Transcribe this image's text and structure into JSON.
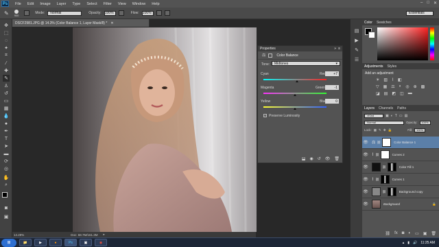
{
  "app": {
    "logo": "Ps"
  },
  "menu": [
    "File",
    "Edit",
    "Image",
    "Layer",
    "Type",
    "Select",
    "Filter",
    "View",
    "Window",
    "Help"
  ],
  "options": {
    "brush_size": "900",
    "mode_label": "Mode:",
    "mode_value": "Normal",
    "opacity_label": "Opacity:",
    "opacity_value": "100%",
    "flow_label": "Flow:",
    "flow_value": "100%",
    "workspace": "Essentials"
  },
  "document": {
    "tab_title": "DSCF2981.JPG @ 14.3% (Color Balance 1, Layer Mask/8) *",
    "zoom": "14.29%",
    "doc_info": "Doc: 68.7M/161.3M"
  },
  "properties": {
    "panel_title": "Properties",
    "adjustment_name": "Color Balance",
    "tone_label": "Tone:",
    "tone_value": "Midtones",
    "sliders": [
      {
        "left": "Cyan",
        "right": "Red",
        "value": "+7",
        "pos": 0.535
      },
      {
        "left": "Magenta",
        "right": "Green",
        "value": "-1",
        "pos": 0.495
      },
      {
        "left": "Yellow",
        "right": "Blue",
        "value": "0",
        "pos": 0.5
      }
    ],
    "preserve_luminosity": "Preserve Luminosity"
  },
  "color_panel": {
    "tabs": [
      "Color",
      "Swatches"
    ]
  },
  "adjustments_panel": {
    "tabs": [
      "Adjustments",
      "Styles"
    ],
    "add_label": "Add an adjustment"
  },
  "layers_panel": {
    "tabs": [
      "Layers",
      "Channels",
      "Paths"
    ],
    "kind_label": "Kind",
    "blend_mode": "Normal",
    "opacity_label": "Opacity:",
    "opacity_value": "100%",
    "lock_label": "Lock:",
    "fill_label": "Fill:",
    "fill_value": "100%",
    "layers": [
      {
        "name": "Color Balance 1",
        "selected": true
      },
      {
        "name": "Curves 2",
        "selected": false
      },
      {
        "name": "Color Fill 1",
        "selected": false
      },
      {
        "name": "Curves 1",
        "selected": false
      },
      {
        "name": "Background copy",
        "selected": false
      },
      {
        "name": "Background",
        "selected": false
      }
    ]
  },
  "taskbar": {
    "time": "11:25 AM"
  },
  "colors": {
    "accent": "#2e6fd1",
    "panel_bg": "#535353",
    "selected_layer": "#5b7fa8"
  }
}
